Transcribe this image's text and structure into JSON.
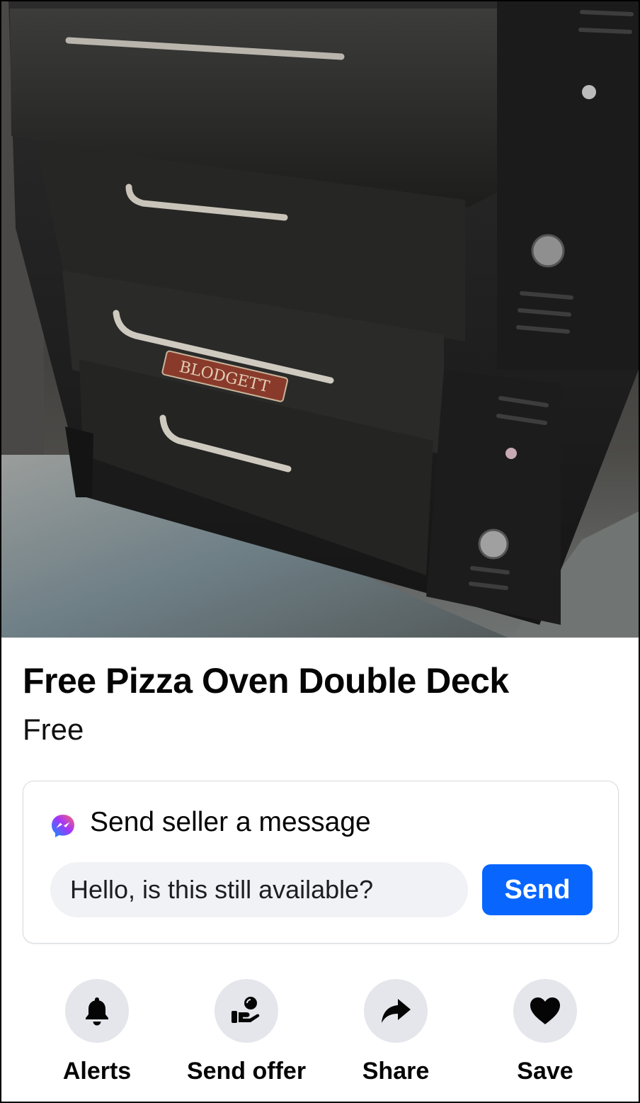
{
  "listing": {
    "title": "Free Pizza Oven Double Deck",
    "price": "Free"
  },
  "photo": {
    "badge_text": "BLODGETT"
  },
  "message": {
    "heading": "Send seller a message",
    "input_value": "Hello, is this still available?",
    "send_label": "Send",
    "icon": "messenger-icon"
  },
  "actions": [
    {
      "label": "Alerts",
      "icon": "bell-icon"
    },
    {
      "label": "Send offer",
      "icon": "offer-hand-icon"
    },
    {
      "label": "Share",
      "icon": "share-arrow-icon"
    },
    {
      "label": "Save",
      "icon": "heart-icon"
    }
  ],
  "colors": {
    "send_button": "#0866ff",
    "action_circle": "#e4e6eb",
    "input_background": "#f0f2f5"
  }
}
